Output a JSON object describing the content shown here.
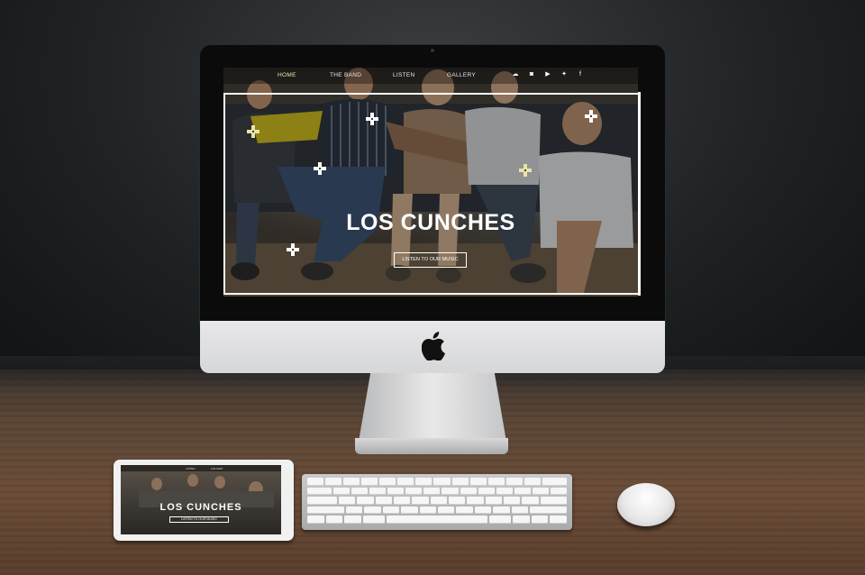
{
  "site": {
    "nav": {
      "home": "HOME",
      "the_band": "THE BAND",
      "listen": "LISTEN",
      "gallery": "GALLERY"
    },
    "social_icons": [
      "soundcloud-icon",
      "instagram-icon",
      "youtube-icon",
      "twitter-icon",
      "facebook-icon"
    ],
    "hero_title": "LOS CUNCHES",
    "hero_button": "LISTEN TO OUR MUSIC",
    "accent_color": "#f2e7a6"
  },
  "tablet": {
    "nav_listen": "LISTEN",
    "nav_gallery": "GALLERY",
    "title": "LOS CUNCHES",
    "button": "LISTEN TO OUR MUSIC"
  }
}
